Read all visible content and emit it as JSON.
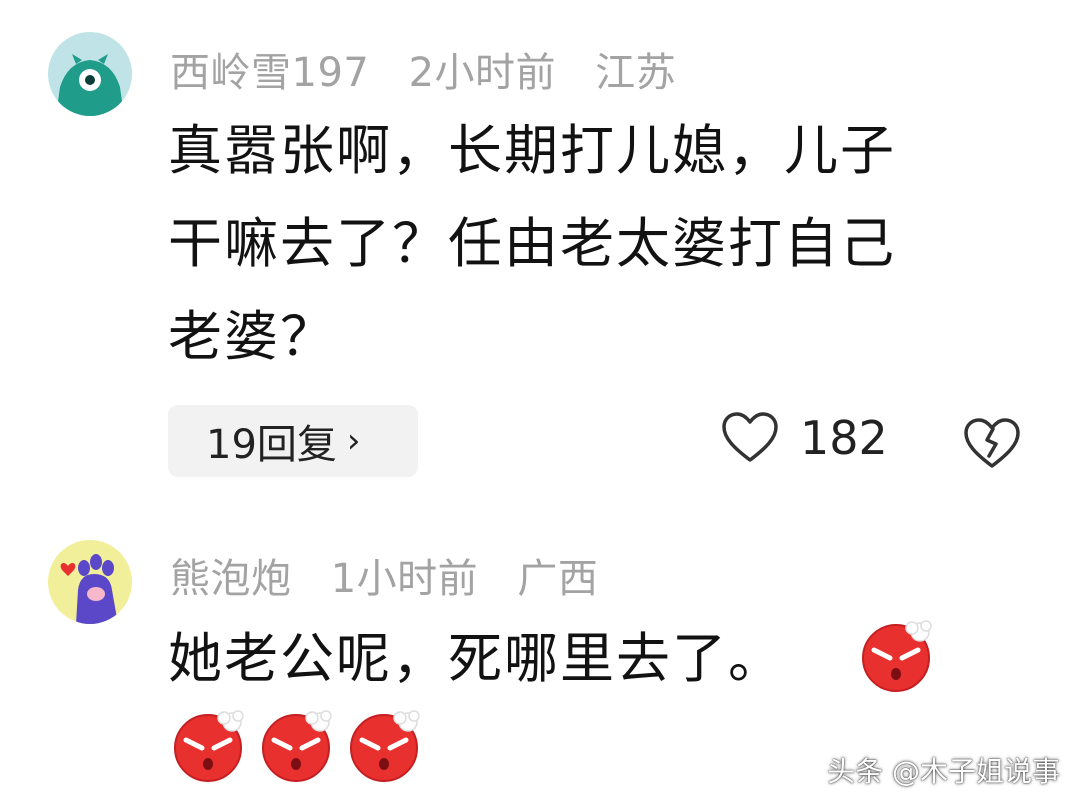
{
  "comments": [
    {
      "username": "西岭雪197",
      "time": "2小时前",
      "location": "江苏",
      "lines": [
        "真嚣张啊，长期打儿媳，儿子",
        "干嘛去了？任由老太婆打自己",
        "老婆？"
      ],
      "reply_label": "19回复",
      "reply_chevron": "›",
      "likes": "182"
    },
    {
      "username": "熊泡炮",
      "time": "1小时前",
      "location": "广西",
      "text": "她老公呢，死哪里去了。"
    }
  ],
  "watermark": "头条 @木子姐说事",
  "colors": {
    "meta_gray": "#a3a3a3",
    "angry_red": "#e8302f",
    "avatar1_bg": "#bfe3e6",
    "avatar2_bg": "#f1ef9a"
  },
  "icons": {
    "like": "heart-outline-icon",
    "dislike": "broken-heart-icon",
    "emoji": "angry-face-emoji"
  }
}
